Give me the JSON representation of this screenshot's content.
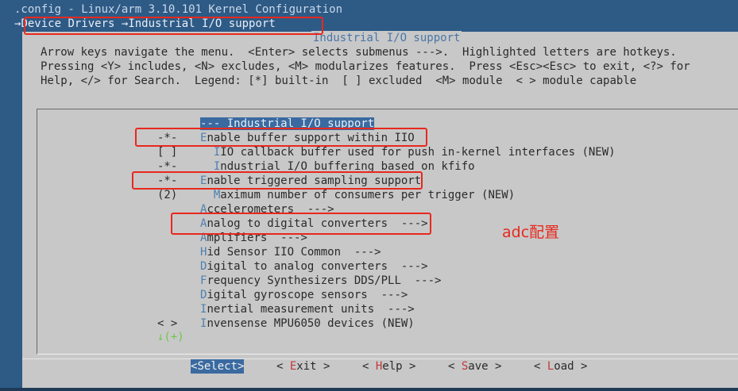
{
  "window": {
    "title": ".config - Linux/arm 3.10.101 Kernel Configuration",
    "breadcrumb": [
      {
        "label": "Device Drivers"
      },
      {
        "label": "Industrial I/O support"
      }
    ],
    "breadcrumb_arrow": "→"
  },
  "dialog": {
    "title": "Industrial I/O support",
    "help_lines": [
      "Arrow keys navigate the menu.  <Enter> selects submenus --->.  Highlighted letters are hotkeys.",
      "Pressing <Y> includes, <N> excludes, <M> modularizes features.  Press <Esc><Esc> to exit, <?> for",
      "Help, </> for Search.  Legend: [*] built-in  [ ] excluded  <M> module  < > module capable"
    ]
  },
  "menu": {
    "items": [
      {
        "prefix": "",
        "label": "--- Industrial I/O support",
        "selected": true,
        "indent": ""
      },
      {
        "prefix": "-*-",
        "label": "Enable buffer support within IIO",
        "hotkey": "E",
        "indent": ""
      },
      {
        "prefix": "[ ]",
        "label": "IIO callback buffer used for push in-kernel interfaces (NEW)",
        "hotkey": "I",
        "indent": "  "
      },
      {
        "prefix": "-*-",
        "label": "Industrial I/O buffering based on kfifo",
        "hotkey": "I",
        "indent": "  "
      },
      {
        "prefix": "-*-",
        "label": "Enable triggered sampling support",
        "hotkey": "E",
        "indent": ""
      },
      {
        "prefix": "(2)",
        "label": "Maximum number of consumers per trigger (NEW)",
        "hotkey": "M",
        "indent": "  "
      },
      {
        "prefix": "",
        "label": "Accelerometers  --->",
        "hotkey": "A",
        "indent": ""
      },
      {
        "prefix": "",
        "label": "Analog to digital converters  --->",
        "hotkey": "A",
        "indent": ""
      },
      {
        "prefix": "",
        "label": "Amplifiers  --->",
        "hotkey": "A",
        "indent": ""
      },
      {
        "prefix": "",
        "label": "Hid Sensor IIO Common  --->",
        "hotkey": "H",
        "indent": ""
      },
      {
        "prefix": "",
        "label": "Digital to analog converters  --->",
        "hotkey": "D",
        "indent": ""
      },
      {
        "prefix": "",
        "label": "Frequency Synthesizers DDS/PLL  --->",
        "hotkey": "F",
        "indent": ""
      },
      {
        "prefix": "",
        "label": "Digital gyroscope sensors  --->",
        "hotkey": "D",
        "indent": ""
      },
      {
        "prefix": "",
        "label": "Inertial measurement units  --->",
        "hotkey": "I",
        "indent": ""
      },
      {
        "prefix": "< >",
        "label": "Invensense MPU6050 devices (NEW)",
        "hotkey": "I",
        "indent": ""
      }
    ],
    "more_indicator": "↓(+)"
  },
  "buttons": [
    {
      "label": "<Select>",
      "hotkey": "S",
      "active": true
    },
    {
      "label": "< Exit >",
      "hotkey": "E",
      "active": false
    },
    {
      "label": "< Help >",
      "hotkey": "H",
      "active": false
    },
    {
      "label": "< Save >",
      "hotkey": "S",
      "active": false
    },
    {
      "label": "< Load >",
      "hotkey": "L",
      "active": false
    }
  ],
  "annotation": {
    "text": "adc配置"
  },
  "colors": {
    "background": "#2e5a86",
    "dialog": "#c8c8c8",
    "selection": "#3a6aa0",
    "hotkey": "#4f7fb0",
    "annotation_red": "#e8281e"
  }
}
